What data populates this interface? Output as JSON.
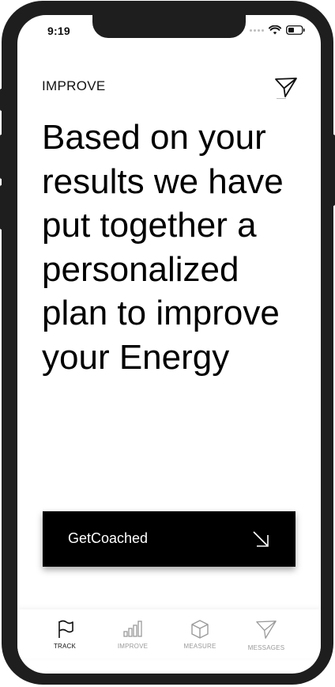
{
  "status_bar": {
    "time": "9:19"
  },
  "header": {
    "title": "IMPROVE",
    "action_icon": "send-icon"
  },
  "headline": "Based on your results we have put together a personalized plan to improve your Energy",
  "cta": {
    "label": "GetCoached",
    "icon": "arrow-down-right-icon"
  },
  "tabs": [
    {
      "label": "TRACK",
      "icon": "flag-icon",
      "active": true
    },
    {
      "label": "IMPROVE",
      "icon": "bar-chart-icon",
      "active": false
    },
    {
      "label": "MEASURE",
      "icon": "cube-icon",
      "active": false
    },
    {
      "label": "MESSAGES",
      "icon": "send-icon",
      "active": false
    }
  ],
  "colors": {
    "frame": "#1e1e1e",
    "background": "#ffffff",
    "text": "#000000",
    "cta_background": "#000000",
    "inactive_tab": "#9a9a9a"
  }
}
